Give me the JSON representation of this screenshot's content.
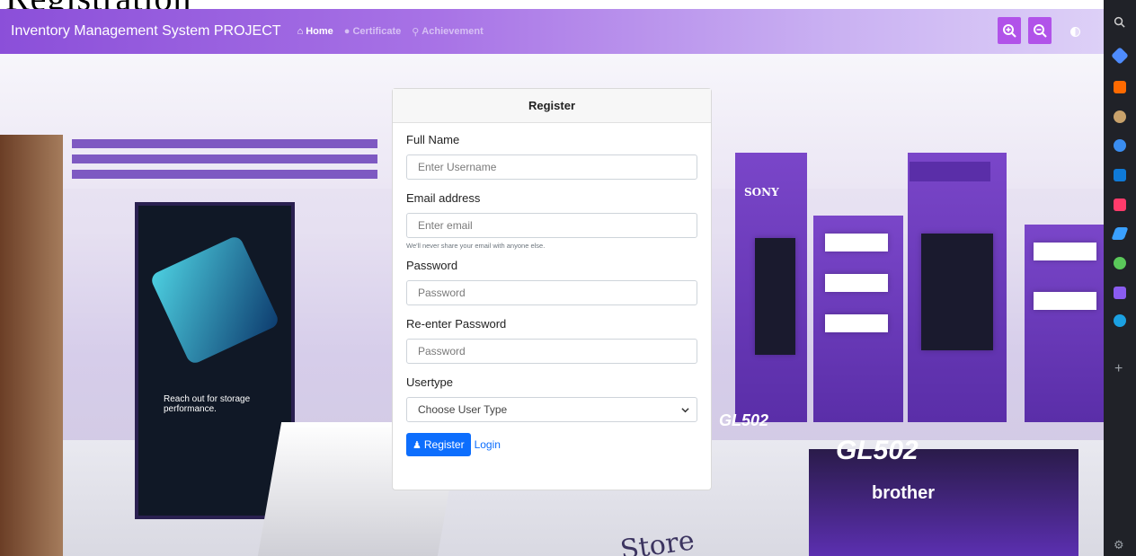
{
  "heading_cropped": "Registration",
  "navbar": {
    "brand": "Inventory Management System PROJECT",
    "links": [
      {
        "label": "Home",
        "icon": "home-icon"
      },
      {
        "label": "Certificate",
        "icon": "circle-icon"
      },
      {
        "label": "Achievement",
        "icon": "trophy-icon"
      }
    ],
    "zoom_in_icon": "zoom-in-icon",
    "zoom_out_icon": "zoom-out-icon",
    "contrast_icon": "contrast-icon"
  },
  "register_form": {
    "title": "Register",
    "full_name": {
      "label": "Full Name",
      "placeholder": "Enter Username"
    },
    "email": {
      "label": "Email address",
      "placeholder": "Enter email",
      "help": "We'll never share your email with anyone else."
    },
    "password": {
      "label": "Password",
      "placeholder": "Password"
    },
    "reenter_password": {
      "label": "Re-enter Password",
      "placeholder": "Password"
    },
    "usertype": {
      "label": "Usertype",
      "selected": "Choose User Type"
    },
    "register_button": "Register",
    "login_link": "Login"
  },
  "background_scene": {
    "brand_texts": [
      "SONY",
      "brother",
      "GL502",
      "Store",
      "Reach out for storage performance."
    ]
  },
  "browser_sidebar": {
    "icons": [
      "search-icon",
      "tag-icon",
      "briefcase-icon",
      "people-icon",
      "copilot-icon",
      "outlook-icon",
      "office-icon",
      "send-icon",
      "tree-icon",
      "onenote-icon",
      "skype-icon",
      "add-icon",
      "settings-icon"
    ],
    "icon_colors": [
      "#4e8cff",
      "#ff6a00",
      "#c8a26b",
      "#3a8df0",
      "#0f7ad8",
      "#ff3b6b",
      "#3aa0ff",
      "#5ac85a",
      "#8a5cf0",
      "#1ba1e2"
    ]
  },
  "colors": {
    "navbar_start": "#8b4fd9",
    "navbar_end": "#ddd0f7",
    "zoom_button": "#b153e9",
    "primary_button": "#0d6efd",
    "sidebar_bg": "#202228"
  }
}
